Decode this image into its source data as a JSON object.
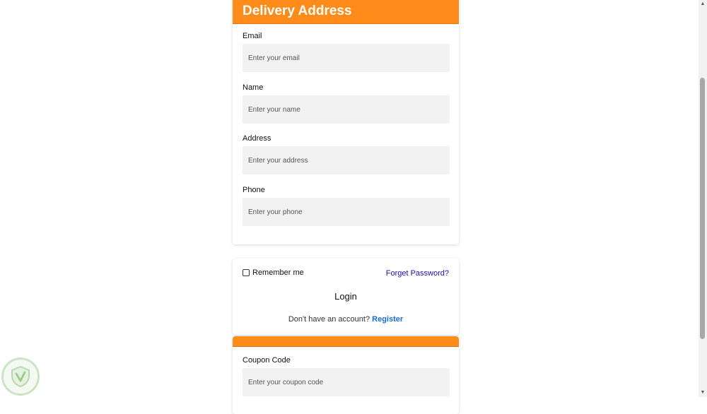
{
  "delivery": {
    "title": "Delivery Address",
    "fields": [
      {
        "label": "Email",
        "placeholder": "Enter your email"
      },
      {
        "label": "Name",
        "placeholder": "Enter your name"
      },
      {
        "label": "Address",
        "placeholder": "Enter your address"
      },
      {
        "label": "Phone",
        "placeholder": "Enter your phone"
      }
    ]
  },
  "login": {
    "remember_label": "Remember me",
    "remember_checked": false,
    "forgot_label": "Forget Password?",
    "login_label": "Login",
    "signup_prompt": "Don't have an account?",
    "register_label": "Register"
  },
  "coupon": {
    "label": "Coupon Code",
    "placeholder": "Enter your coupon code"
  },
  "colors": {
    "accent": "#ff8c1a",
    "link": "#1a0dab",
    "register_link": "#1a6ad8",
    "input_bg": "#f2f2f2"
  },
  "icons": {
    "checkbox": "checkbox-icon",
    "scroll_up": "triangle-up-icon",
    "scroll_down": "triangle-down-icon",
    "logo": "shield-logo-icon"
  }
}
